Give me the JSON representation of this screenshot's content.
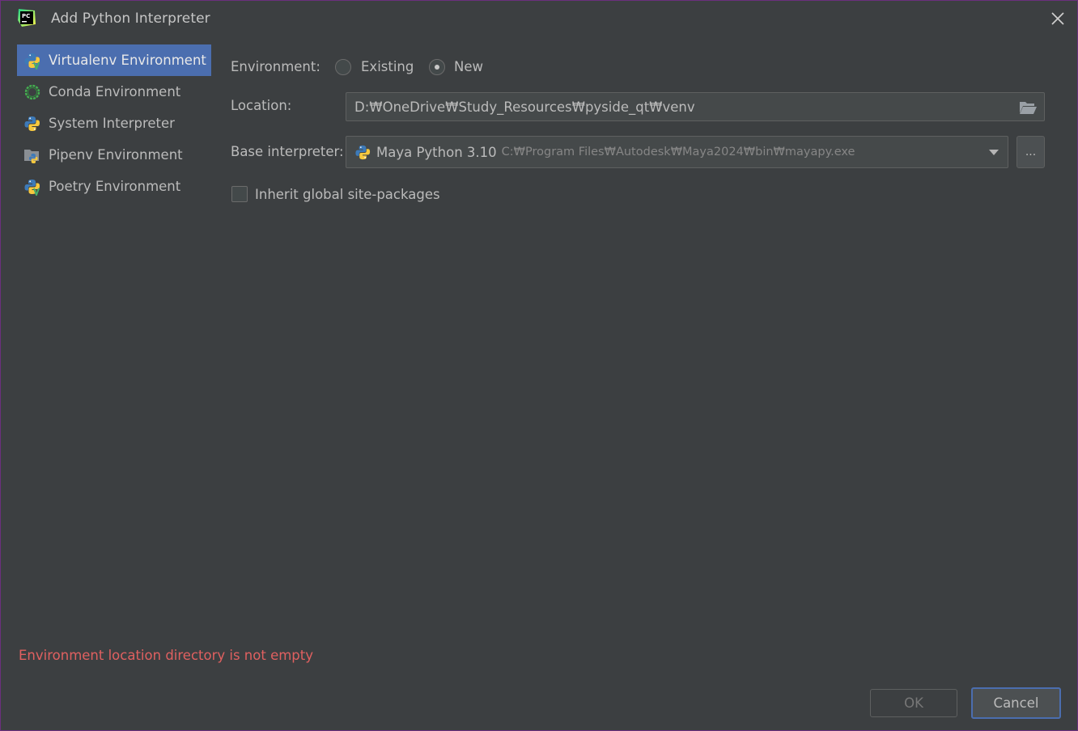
{
  "window": {
    "title": "Add Python Interpreter",
    "app_icon_text": "PC"
  },
  "sidebar": {
    "items": [
      {
        "label": "Virtualenv Environment",
        "icon": "python-venv-icon",
        "selected": true
      },
      {
        "label": "Conda Environment",
        "icon": "conda-icon",
        "selected": false
      },
      {
        "label": "System Interpreter",
        "icon": "python-icon",
        "selected": false
      },
      {
        "label": "Pipenv Environment",
        "icon": "pipenv-icon",
        "selected": false
      },
      {
        "label": "Poetry Environment",
        "icon": "poetry-icon",
        "selected": false
      }
    ]
  },
  "form": {
    "environment_label": "Environment:",
    "environment_options": [
      {
        "label": "Existing",
        "checked": false
      },
      {
        "label": "New",
        "checked": true
      }
    ],
    "location_label": "Location:",
    "location_value": "D:₩OneDrive₩Study_Resources₩pyside_qt₩venv",
    "base_interpreter_label": "Base interpreter:",
    "base_interpreter_name": "Maya Python 3.10",
    "base_interpreter_path": "C:₩Program Files₩Autodesk₩Maya2024₩bin₩mayapy.exe",
    "browse_label": "...",
    "inherit_label": "Inherit global site-packages",
    "inherit_checked": false
  },
  "status": {
    "error": "Environment location directory is not empty"
  },
  "buttons": {
    "ok": "OK",
    "cancel": "Cancel"
  },
  "colors": {
    "background": "#3c3f41",
    "selection": "#4b6eaf",
    "error": "#e06060",
    "python_blue": "#3d7ab8",
    "python_yellow": "#f7c93e"
  }
}
